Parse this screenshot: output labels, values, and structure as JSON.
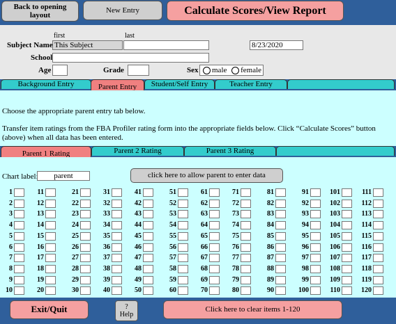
{
  "toolbar": {
    "back_label_line1": "Back to opening",
    "back_label_line2": "layout",
    "new_entry_label": "New Entry",
    "calculate_label": "Calculate Scores/View Report"
  },
  "subject": {
    "first_label": "first",
    "last_label": "last",
    "name_label": "Subject Name",
    "first_value": "This Subject",
    "last_value": "",
    "date_value": "8/23/2020",
    "school_label": "School",
    "school_value": "",
    "age_label": "Age",
    "age_value": "",
    "grade_label": "Grade",
    "grade_value": "",
    "sex_label": "Sex",
    "sex_options": [
      "male",
      "female"
    ]
  },
  "tabs": {
    "background": "Background Entry",
    "parent": "Parent Entry",
    "student": "Student/Self Entry",
    "teacher": "Teacher Entry"
  },
  "instructions": {
    "line1": "Choose the appropriate parent entry tab below.",
    "line2": "Transfer item ratings from the FBA Profiler rating form into the appropriate fields below.  Click “Calculate Scores” button (above) when all data has been entered."
  },
  "rating_tabs": {
    "r1": "Parent 1 Rating",
    "r2": "Parent 2 Rating",
    "r3": "Parent 3 Rating"
  },
  "chart": {
    "label": "Chart label:",
    "value": "parent",
    "allow_button": "click here to allow parent to enter data"
  },
  "items_total": 120,
  "footer": {
    "exit_label": "Exit/Quit",
    "help_q": "?",
    "help_label": "Help",
    "clear_label": "Click here to clear items 1-120"
  }
}
